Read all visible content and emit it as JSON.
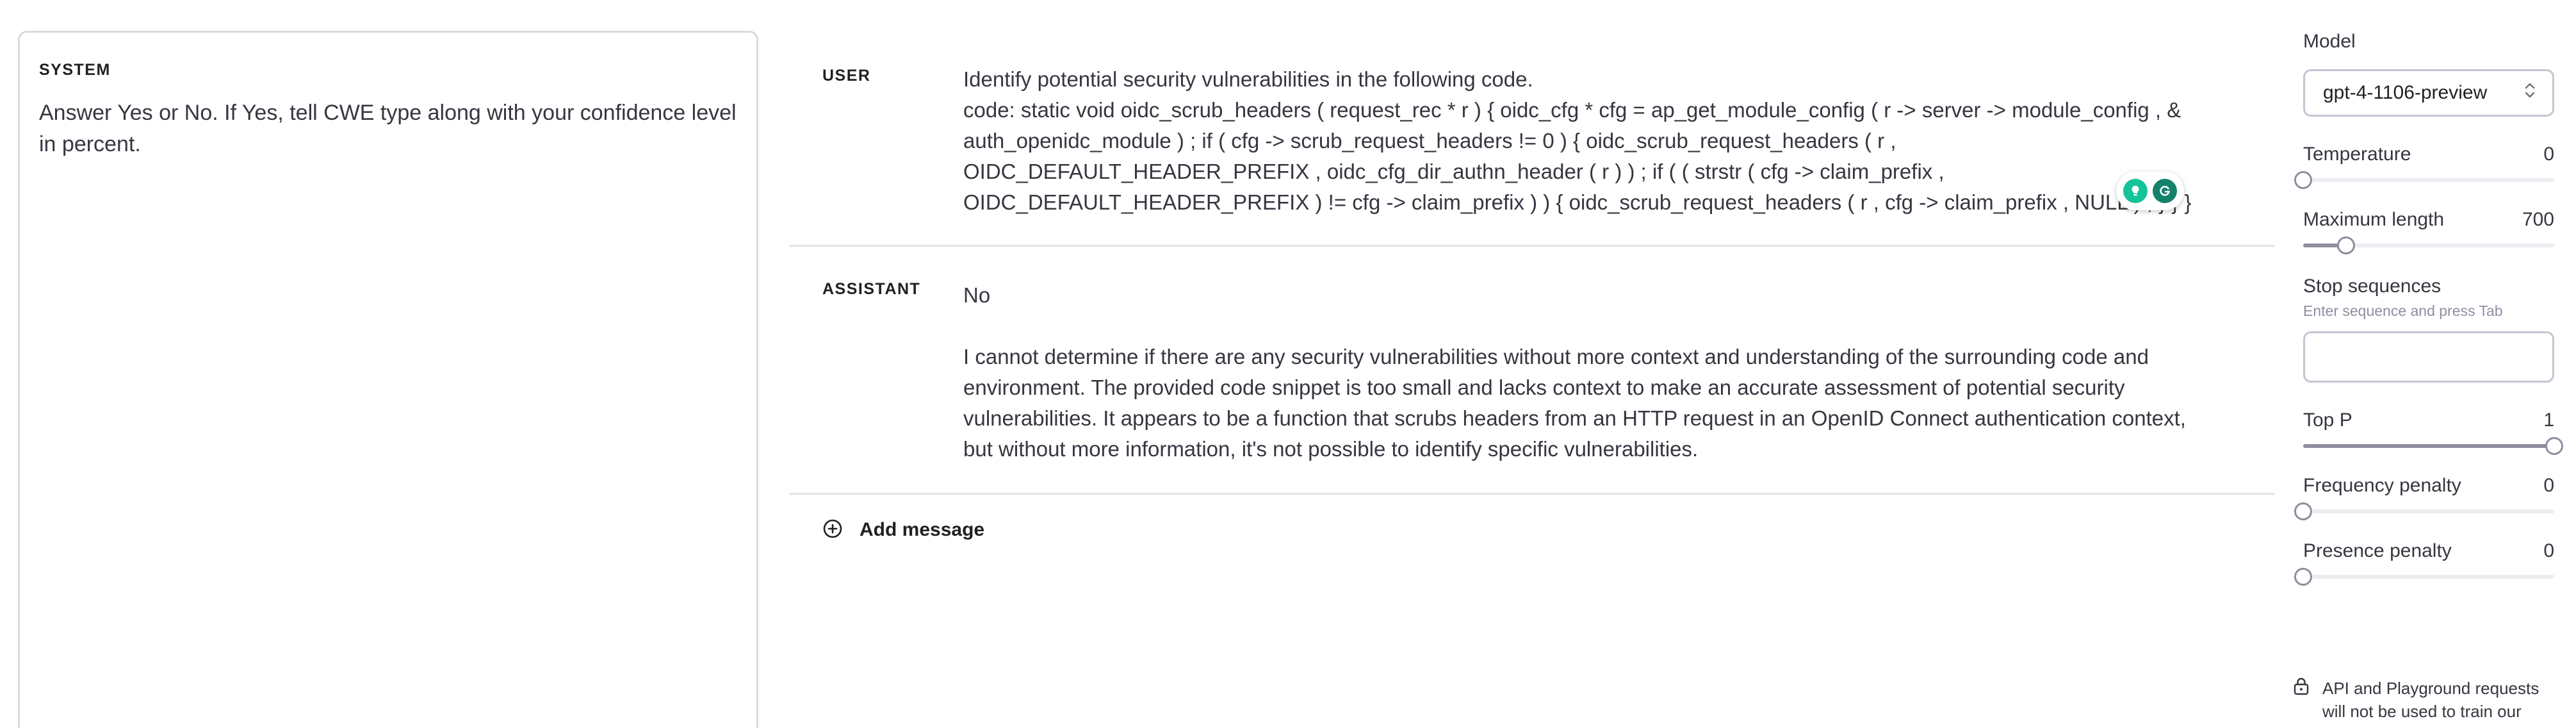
{
  "system": {
    "label": "SYSTEM",
    "text": "Answer Yes or No. If Yes, tell CWE type along with your confidence level in percent."
  },
  "messages": [
    {
      "role": "USER",
      "paragraphs": [
        "Identify potential security vulnerabilities in the following code.\ncode: static void oidc_scrub_headers ( request_rec * r ) { oidc_cfg * cfg = ap_get_module_config ( r -> server -> module_config , & auth_openidc_module ) ; if ( cfg -> scrub_request_headers != 0 ) { oidc_scrub_request_headers ( r , OIDC_DEFAULT_HEADER_PREFIX , oidc_cfg_dir_authn_header ( r ) ) ; if ( ( strstr ( cfg -> claim_prefix , OIDC_DEFAULT_HEADER_PREFIX ) != cfg -> claim_prefix ) ) { oidc_scrub_request_headers ( r , cfg -> claim_prefix , NULL ) ; } } }"
      ]
    },
    {
      "role": "ASSISTANT",
      "paragraphs": [
        "No",
        "I cannot determine if there are any security vulnerabilities without more context and understanding of the surrounding code and environment. The provided code snippet is too small and lacks context to make an accurate assessment of potential security vulnerabilities. It appears to be a function that scrubs headers from an HTTP request in an OpenID Connect authentication context, but without more information, it's not possible to identify specific vulnerabilities."
      ]
    }
  ],
  "add_message": {
    "label": "Add message",
    "icon": "plus-circle-icon"
  },
  "settings": {
    "model": {
      "label": "Model",
      "value": "gpt-4-1106-preview",
      "icon": "chevron-up-down-icon"
    },
    "temperature": {
      "label": "Temperature",
      "value": "0",
      "fraction": 0
    },
    "max_length": {
      "label": "Maximum length",
      "value": "700",
      "fraction": 0.17
    },
    "stop_sequences": {
      "label": "Stop sequences",
      "hint": "Enter sequence and press Tab",
      "value": ""
    },
    "top_p": {
      "label": "Top P",
      "value": "1",
      "fraction": 1
    },
    "frequency_penalty": {
      "label": "Frequency penalty",
      "value": "0",
      "fraction": 0
    },
    "presence_penalty": {
      "label": "Presence penalty",
      "value": "0",
      "fraction": 0
    },
    "privacy_note": "API and Playground requests will not be used to train our"
  },
  "colors": {
    "accent_green": "#15c39a",
    "grammarly_green": "#15816a",
    "border": "#d9d9e3"
  }
}
